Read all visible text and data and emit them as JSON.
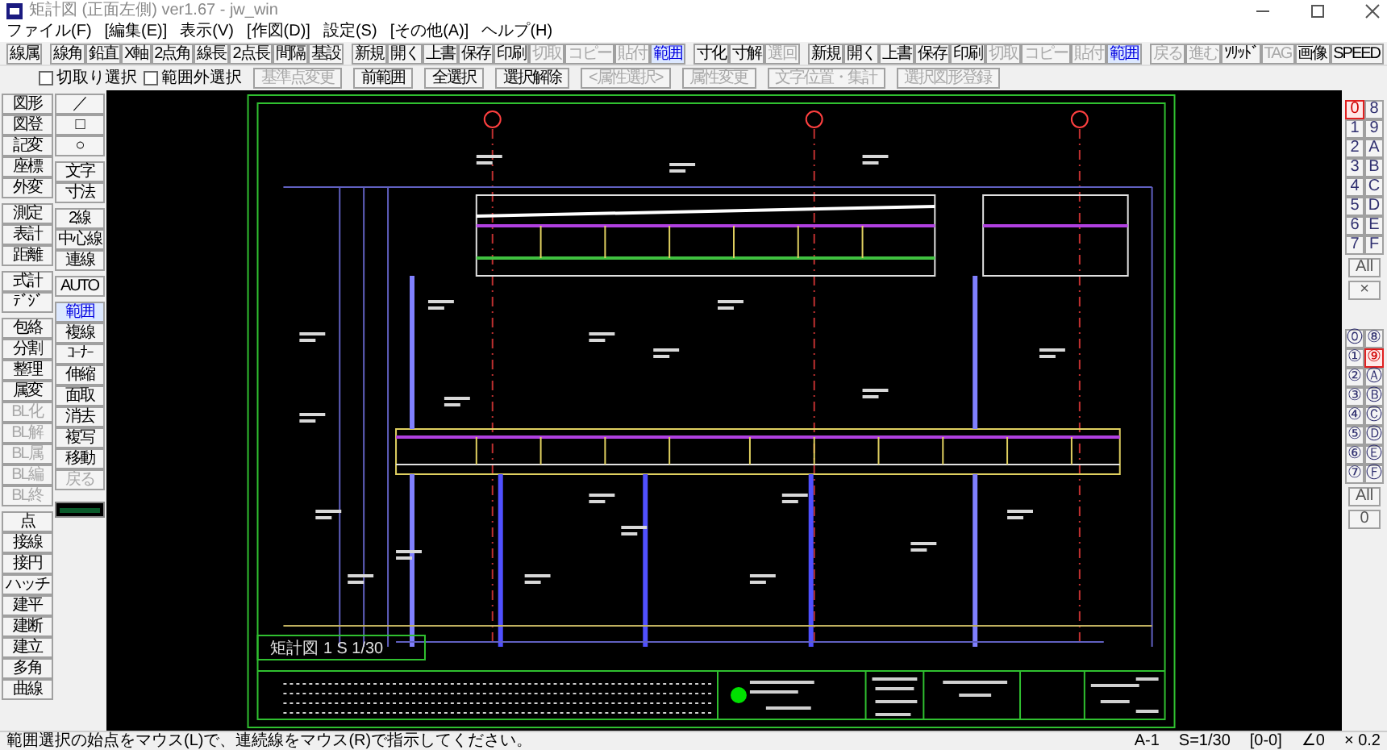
{
  "window": {
    "title": "矩計図 (正面左側) ver1.67 - jw_win"
  },
  "menu": [
    {
      "label": "ファイル(F)"
    },
    {
      "label": "[編集(E)]"
    },
    {
      "label": "表示(V)"
    },
    {
      "label": "[作図(D)]"
    },
    {
      "label": "設定(S)"
    },
    {
      "label": "[その他(A)]"
    },
    {
      "label": "ヘルプ(H)"
    }
  ],
  "toolbar_1": [
    [
      {
        "label": "線属",
        "disabled": false,
        "selected": false
      }
    ],
    [
      {
        "label": "線角",
        "disabled": false,
        "selected": false
      },
      {
        "label": "鉛直",
        "disabled": false,
        "selected": false
      },
      {
        "label": "X軸",
        "disabled": false,
        "selected": false
      },
      {
        "label": "2点角",
        "disabled": false,
        "selected": false
      },
      {
        "label": "線長",
        "disabled": false,
        "selected": false
      },
      {
        "label": "2点長",
        "disabled": false,
        "selected": false
      },
      {
        "label": "間隔",
        "disabled": false,
        "selected": false
      },
      {
        "label": "基設",
        "disabled": false,
        "selected": false
      }
    ],
    [
      {
        "label": "新規",
        "disabled": false,
        "selected": false
      },
      {
        "label": "開く",
        "disabled": false,
        "selected": false
      },
      {
        "label": "上書",
        "disabled": false,
        "selected": false
      },
      {
        "label": "保存",
        "disabled": false,
        "selected": false
      },
      {
        "label": "印刷",
        "disabled": false,
        "selected": false
      },
      {
        "label": "切取",
        "disabled": true,
        "selected": false
      },
      {
        "label": "コピー",
        "disabled": true,
        "selected": false
      },
      {
        "label": "貼付",
        "disabled": true,
        "selected": false
      },
      {
        "label": "範囲",
        "disabled": false,
        "selected": true
      }
    ],
    [
      {
        "label": "寸化",
        "disabled": false,
        "selected": false
      },
      {
        "label": "寸解",
        "disabled": false,
        "selected": false
      },
      {
        "label": "選回",
        "disabled": true,
        "selected": false
      }
    ],
    [
      {
        "label": "新規",
        "disabled": false,
        "selected": false
      },
      {
        "label": "開く",
        "disabled": false,
        "selected": false
      },
      {
        "label": "上書",
        "disabled": false,
        "selected": false
      },
      {
        "label": "保存",
        "disabled": false,
        "selected": false
      },
      {
        "label": "印刷",
        "disabled": false,
        "selected": false
      },
      {
        "label": "切取",
        "disabled": true,
        "selected": false
      },
      {
        "label": "コピー",
        "disabled": true,
        "selected": false
      },
      {
        "label": "貼付",
        "disabled": true,
        "selected": false
      },
      {
        "label": "範囲",
        "disabled": false,
        "selected": true
      }
    ],
    [
      {
        "label": "戻る",
        "disabled": true,
        "selected": false
      },
      {
        "label": "進む",
        "disabled": true,
        "selected": false
      },
      {
        "label": "ｿﾘｯﾄﾞ",
        "disabled": false,
        "selected": false
      },
      {
        "label": "TAG",
        "disabled": true,
        "selected": false
      },
      {
        "label": "画像",
        "disabled": false,
        "selected": false
      },
      {
        "label": "SPEED",
        "disabled": false,
        "selected": false
      }
    ]
  ],
  "toolbar_2": [
    {
      "kind": "checkbox",
      "label": "切取り選択",
      "checked": false
    },
    {
      "kind": "checkbox",
      "label": "範囲外選択",
      "checked": false
    },
    {
      "kind": "button",
      "label": "基準点変更",
      "disabled": true
    },
    {
      "kind": "button",
      "label": "前範囲",
      "disabled": false
    },
    {
      "kind": "button",
      "label": "全選択",
      "disabled": false
    },
    {
      "kind": "button",
      "label": "選択解除",
      "disabled": false
    },
    {
      "kind": "button",
      "label": "<属性選択>",
      "disabled": true
    },
    {
      "kind": "button",
      "label": "属性変更",
      "disabled": true
    },
    {
      "kind": "button",
      "label": "文字位置・集計",
      "disabled": true
    },
    {
      "kind": "button",
      "label": "選択図形登録",
      "disabled": true
    }
  ],
  "left_toolbar": {
    "column_1": [
      [
        {
          "label": "図形",
          "disabled": false,
          "selected": false
        },
        {
          "label": "図登",
          "disabled": false,
          "selected": false
        },
        {
          "label": "記変",
          "disabled": false,
          "selected": false
        },
        {
          "label": "座標",
          "disabled": false,
          "selected": false
        },
        {
          "label": "外変",
          "disabled": false,
          "selected": false
        }
      ],
      [
        {
          "label": "測定",
          "disabled": false,
          "selected": false
        },
        {
          "label": "表計",
          "disabled": false,
          "selected": false
        },
        {
          "label": "距離",
          "disabled": false,
          "selected": false
        }
      ],
      [
        {
          "label": "式計",
          "disabled": false,
          "selected": false
        },
        {
          "label": "ﾃﾞｼﾞ",
          "disabled": false,
          "selected": false
        }
      ],
      [
        {
          "label": "包絡",
          "disabled": false,
          "selected": false
        },
        {
          "label": "分割",
          "disabled": false,
          "selected": false
        },
        {
          "label": "整理",
          "disabled": false,
          "selected": false
        },
        {
          "label": "属変",
          "disabled": false,
          "selected": false
        },
        {
          "label": "BL化",
          "disabled": true,
          "selected": false
        },
        {
          "label": "BL解",
          "disabled": true,
          "selected": false
        },
        {
          "label": "BL属",
          "disabled": true,
          "selected": false
        },
        {
          "label": "BL編",
          "disabled": true,
          "selected": false
        },
        {
          "label": "BL終",
          "disabled": true,
          "selected": false
        }
      ],
      [
        {
          "label": "点",
          "disabled": false,
          "selected": false
        },
        {
          "label": "接線",
          "disabled": false,
          "selected": false
        },
        {
          "label": "接円",
          "disabled": false,
          "selected": false
        },
        {
          "label": "ハッチ",
          "disabled": false,
          "selected": false
        },
        {
          "label": "建平",
          "disabled": false,
          "selected": false
        },
        {
          "label": "建断",
          "disabled": false,
          "selected": false
        },
        {
          "label": "建立",
          "disabled": false,
          "selected": false
        },
        {
          "label": "多角",
          "disabled": false,
          "selected": false
        },
        {
          "label": "曲線",
          "disabled": false,
          "selected": false
        }
      ]
    ],
    "column_2": [
      [
        {
          "label": "／",
          "disabled": false,
          "selected": false
        },
        {
          "label": "□",
          "disabled": false,
          "selected": false
        },
        {
          "label": "○",
          "disabled": false,
          "selected": false
        }
      ],
      [
        {
          "label": "文字",
          "disabled": false,
          "selected": false
        },
        {
          "label": "寸法",
          "disabled": false,
          "selected": false
        }
      ],
      [
        {
          "label": "2線",
          "disabled": false,
          "selected": false
        },
        {
          "label": "中心線",
          "disabled": false,
          "selected": false
        },
        {
          "label": "連線",
          "disabled": false,
          "selected": false
        }
      ],
      [
        {
          "label": "AUTO",
          "disabled": false,
          "selected": false
        }
      ],
      [
        {
          "label": "範囲",
          "disabled": false,
          "selected": true
        },
        {
          "label": "複線",
          "disabled": false,
          "selected": false
        },
        {
          "label": "ｺｰﾅｰ",
          "disabled": false,
          "selected": false
        },
        {
          "label": "伸縮",
          "disabled": false,
          "selected": false
        },
        {
          "label": "面取",
          "disabled": false,
          "selected": false
        },
        {
          "label": "消去",
          "disabled": false,
          "selected": false
        },
        {
          "label": "複写",
          "disabled": false,
          "selected": false
        },
        {
          "label": "移動",
          "disabled": false,
          "selected": false
        },
        {
          "label": "戻る",
          "disabled": true,
          "selected": false
        }
      ]
    ]
  },
  "right_panel": {
    "layer_groups": [
      {
        "label": "0",
        "selected": true
      },
      {
        "label": "8",
        "selected": false
      },
      {
        "label": "1",
        "selected": false
      },
      {
        "label": "9",
        "selected": false
      },
      {
        "label": "2",
        "selected": false
      },
      {
        "label": "A",
        "selected": false
      },
      {
        "label": "3",
        "selected": false
      },
      {
        "label": "B",
        "selected": false
      },
      {
        "label": "4",
        "selected": false
      },
      {
        "label": "C",
        "selected": false
      },
      {
        "label": "5",
        "selected": false
      },
      {
        "label": "D",
        "selected": false
      },
      {
        "label": "6",
        "selected": false
      },
      {
        "label": "E",
        "selected": false
      },
      {
        "label": "7",
        "selected": false
      },
      {
        "label": "F",
        "selected": false
      }
    ],
    "layer_groups_all": "All",
    "layer_groups_close": "×",
    "layers": [
      {
        "label": "⓪",
        "selected": false
      },
      {
        "label": "⑧",
        "selected": false
      },
      {
        "label": "①",
        "selected": false
      },
      {
        "label": "⑨",
        "selected": true
      },
      {
        "label": "②",
        "selected": false
      },
      {
        "label": "Ⓐ",
        "selected": false
      },
      {
        "label": "③",
        "selected": false
      },
      {
        "label": "Ⓑ",
        "selected": false
      },
      {
        "label": "④",
        "selected": false
      },
      {
        "label": "Ⓒ",
        "selected": false
      },
      {
        "label": "⑤",
        "selected": false
      },
      {
        "label": "Ⓓ",
        "selected": false
      },
      {
        "label": "⑥",
        "selected": false
      },
      {
        "label": "Ⓔ",
        "selected": false
      },
      {
        "label": "⑦",
        "selected": false
      },
      {
        "label": "Ⓕ",
        "selected": false
      }
    ],
    "layers_all": "All",
    "layer_current": "0"
  },
  "drawing": {
    "scale_label": "矩計図 1 S 1/30"
  },
  "status_bar": {
    "message": "範囲選択の始点をマウス(L)で、連続線をマウス(R)で指示してください。",
    "fields": [
      "A-1",
      "S=1/30",
      "[0-0]",
      "∠0",
      "× 0.2"
    ]
  }
}
